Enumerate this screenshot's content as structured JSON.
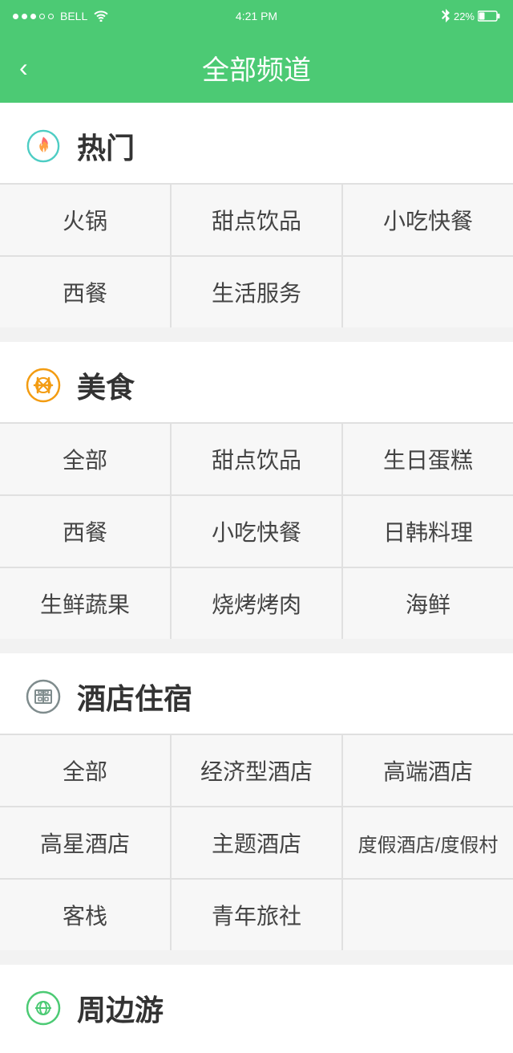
{
  "statusBar": {
    "carrier": "BELL",
    "time": "4:21 PM",
    "battery": "22%"
  },
  "navBar": {
    "title": "全部频道",
    "backLabel": "‹"
  },
  "sections": [
    {
      "id": "hot",
      "iconType": "hot",
      "title": "热门",
      "items": [
        [
          "火锅",
          "甜点饮品",
          "小吃快餐"
        ],
        [
          "西餐",
          "生活服务",
          ""
        ]
      ]
    },
    {
      "id": "food",
      "iconType": "food",
      "title": "美食",
      "items": [
        [
          "全部",
          "甜点饮品",
          "生日蛋糕"
        ],
        [
          "西餐",
          "小吃快餐",
          "日韩料理"
        ],
        [
          "生鲜蔬果",
          "烧烤烤肉",
          "海鲜"
        ]
      ]
    },
    {
      "id": "hotel",
      "iconType": "hotel",
      "title": "酒店住宿",
      "items": [
        [
          "全部",
          "经济型酒店",
          "高端酒店"
        ],
        [
          "高星酒店",
          "主题酒店",
          "度假酒店/度假村"
        ],
        [
          "客栈",
          "青年旅社",
          ""
        ]
      ]
    },
    {
      "id": "travel",
      "iconType": "travel",
      "title": "周边游",
      "items": []
    }
  ]
}
